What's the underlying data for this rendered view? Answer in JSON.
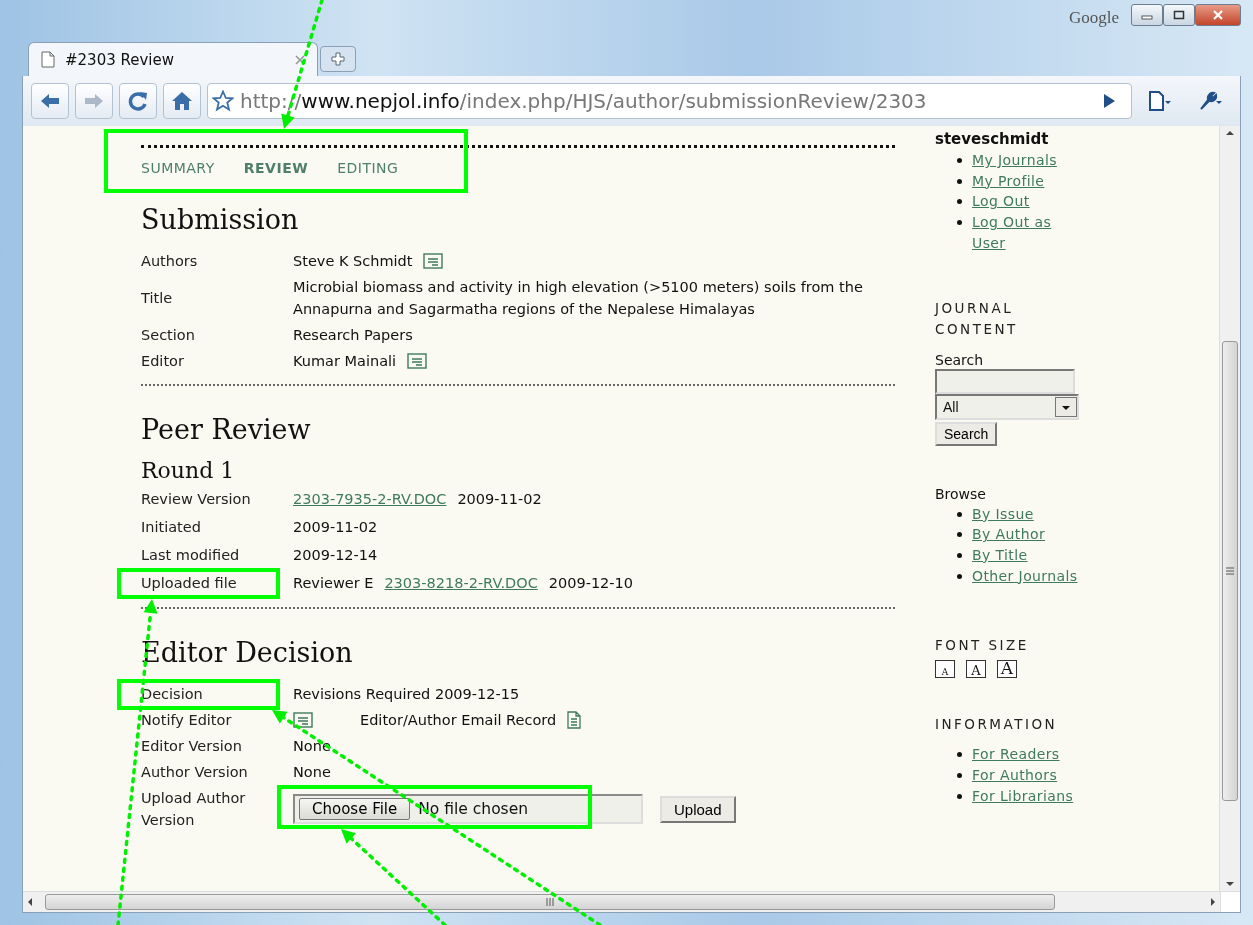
{
  "window": {
    "brand": "Google",
    "tab": {
      "title": "#2303 Review"
    },
    "address": {
      "scheme": "http://",
      "host": "www.nepjol.info",
      "path": "/index.php/HJS/author/submissionReview/2303"
    }
  },
  "page_tabs": {
    "highlighted": true,
    "items": [
      {
        "label": "SUMMARY",
        "selected": false
      },
      {
        "label": "REVIEW",
        "selected": true
      },
      {
        "label": "EDITING",
        "selected": false
      }
    ]
  },
  "sections": [
    {
      "heading": "Submission",
      "rows": [
        {
          "label": "Authors",
          "highlighted": false,
          "parts": [
            {
              "kind": "text",
              "text": "Steve K Schmidt"
            },
            {
              "kind": "email"
            }
          ]
        },
        {
          "label": "Title",
          "highlighted": false,
          "parts": [
            {
              "kind": "text",
              "text": "Microbial biomass and activity in high elevation (>5100 meters) soils from the Annapurna and Sagarmatha regions of the Nepalese Himalayas"
            }
          ]
        },
        {
          "label": "Section",
          "highlighted": false,
          "parts": [
            {
              "kind": "text",
              "text": "Research Papers"
            }
          ]
        },
        {
          "label": "Editor",
          "highlighted": false,
          "parts": [
            {
              "kind": "text",
              "text": "Kumar Mainali"
            },
            {
              "kind": "email"
            }
          ]
        }
      ]
    },
    {
      "heading": "Peer Review",
      "subheading": "Round 1",
      "rows": [
        {
          "label": "Review Version",
          "highlighted": false,
          "parts": [
            {
              "kind": "link",
              "text": "2303-7935-2-RV.DOC"
            },
            {
              "kind": "text",
              "text": "2009-11-02"
            }
          ]
        },
        {
          "label": "Initiated",
          "highlighted": false,
          "parts": [
            {
              "kind": "text",
              "text": "2009-11-02"
            }
          ]
        },
        {
          "label": "Last modified",
          "highlighted": false,
          "parts": [
            {
              "kind": "text",
              "text": "2009-12-14"
            }
          ]
        },
        {
          "label": "Uploaded file",
          "highlighted": true,
          "parts": [
            {
              "kind": "text",
              "text": "Reviewer E"
            },
            {
              "kind": "link",
              "text": "2303-8218-2-RV.DOC"
            },
            {
              "kind": "text",
              "text": "2009-12-10"
            }
          ]
        }
      ]
    },
    {
      "heading": "Editor Decision",
      "rows": [
        {
          "label": "Decision",
          "highlighted": true,
          "parts": [
            {
              "kind": "text",
              "text": "Revisions Required 2009-12-15"
            }
          ]
        },
        {
          "label": "Notify Editor",
          "highlighted": false,
          "parts": [
            {
              "kind": "email"
            },
            {
              "kind": "text",
              "text": "Editor/Author Email Record"
            },
            {
              "kind": "doc"
            }
          ]
        },
        {
          "label": "Editor Version",
          "highlighted": false,
          "parts": [
            {
              "kind": "text",
              "text": "None"
            }
          ]
        },
        {
          "label": "Author Version",
          "highlighted": false,
          "parts": [
            {
              "kind": "text",
              "text": "None"
            }
          ]
        },
        {
          "label": "Upload Author Version",
          "highlighted": false,
          "parts": [
            {
              "kind": "file",
              "button": "Choose File",
              "status": "No file chosen",
              "highlighted": true
            },
            {
              "kind": "button",
              "text": "Upload"
            }
          ]
        }
      ]
    }
  ],
  "sidebar": {
    "user": "steveschmidt",
    "user_links": [
      "My Journals",
      "My Profile",
      "Log Out",
      "Log Out as User"
    ],
    "journal_content": {
      "heading": "JOURNAL CONTENT",
      "search_label": "Search",
      "select": "All",
      "button": "Search"
    },
    "browse": {
      "heading": "Browse",
      "links": [
        "By Issue",
        "By Author",
        "By Title",
        "Other Journals"
      ]
    },
    "font_size": {
      "heading": "FONT SIZE",
      "letters": [
        "A",
        "A",
        "A"
      ]
    },
    "information": {
      "heading": "INFORMATION",
      "links": [
        "For Readers",
        "For Authors",
        "For Librarians"
      ]
    }
  }
}
